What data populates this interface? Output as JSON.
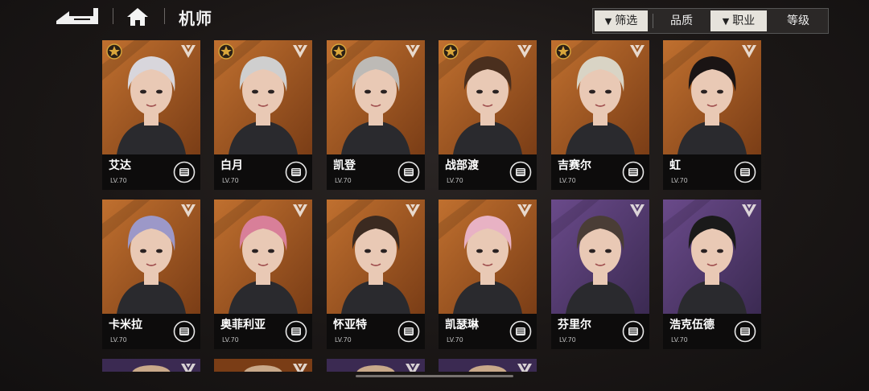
{
  "header": {
    "title": "机师",
    "back_icon": "back-arrow-icon",
    "home_icon": "home-icon"
  },
  "filters": {
    "screen": "筛选",
    "quality": "品质",
    "profession": "职业",
    "level": "等级"
  },
  "colors": {
    "accent": "#e6e3dc",
    "card_orange": "#b5632a",
    "card_purple": "#5a3d7a",
    "name_bar": "#0d0c0c",
    "badge_gold": "#d9a63b"
  },
  "pilots": [
    {
      "name": "艾达",
      "level": "LV.70",
      "theme": "orange",
      "star_badge": true,
      "hair": "#d8d6dc",
      "role_icon": "fist-icon"
    },
    {
      "name": "白月",
      "level": "LV.70",
      "theme": "orange",
      "star_badge": true,
      "hair": "#cfcfcf",
      "role_icon": "fist-icon"
    },
    {
      "name": "凯登",
      "level": "LV.70",
      "theme": "orange",
      "star_badge": true,
      "hair": "#bdbab6",
      "role_icon": "fist-icon"
    },
    {
      "name": "战部渡",
      "level": "LV.70",
      "theme": "orange",
      "star_badge": true,
      "hair": "#4a2f1e",
      "role_icon": "fist-icon"
    },
    {
      "name": "吉赛尔",
      "level": "LV.70",
      "theme": "orange",
      "star_badge": true,
      "hair": "#d9d4c5",
      "role_icon": "fist-icon"
    },
    {
      "name": "虹",
      "level": "LV.70",
      "theme": "orange",
      "star_badge": false,
      "hair": "#1a1414",
      "role_icon": "fist-icon"
    },
    {
      "name": "卡米拉",
      "level": "LV.70",
      "theme": "orange",
      "star_badge": false,
      "hair": "#9c98c8",
      "role_icon": "fist-icon"
    },
    {
      "name": "奥菲利亚",
      "level": "LV.70",
      "theme": "orange",
      "star_badge": false,
      "hair": "#d87f99",
      "role_icon": "fist-icon"
    },
    {
      "name": "怀亚特",
      "level": "LV.70",
      "theme": "orange",
      "star_badge": false,
      "hair": "#3b2a20",
      "role_icon": "fist-icon"
    },
    {
      "name": "凯瑟琳",
      "level": "LV.70",
      "theme": "orange",
      "star_badge": false,
      "hair": "#e8b2c4",
      "role_icon": "fist-icon"
    },
    {
      "name": "芬里尔",
      "level": "LV.70",
      "theme": "purple",
      "star_badge": false,
      "hair": "#4a3d36",
      "role_icon": "fist-icon"
    },
    {
      "name": "浩克伍德",
      "level": "LV.70",
      "theme": "purple",
      "star_badge": false,
      "hair": "#1a1a1a",
      "role_icon": "fist-icon"
    }
  ]
}
